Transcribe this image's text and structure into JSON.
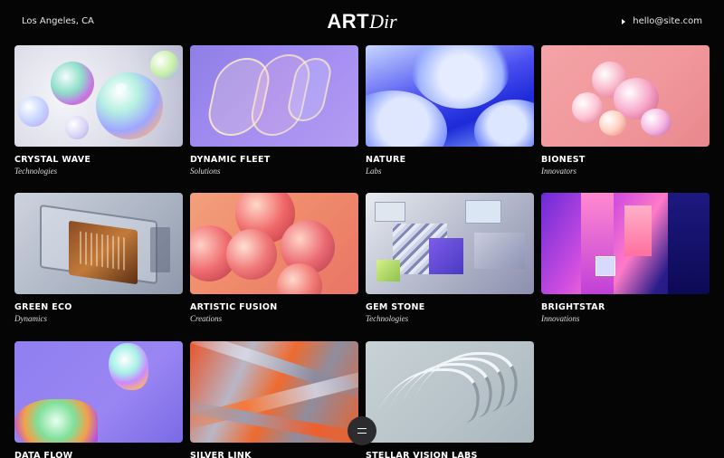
{
  "header": {
    "location": "Los Angeles, CA",
    "logo_bold": "ART",
    "logo_italic": "Dir",
    "contact_email": "hello@site.com"
  },
  "projects": [
    {
      "title": "CRYSTAL WAVE",
      "subtitle": "Technologies"
    },
    {
      "title": "DYNAMIC FLEET",
      "subtitle": "Solutions"
    },
    {
      "title": "NATURE",
      "subtitle": "Labs"
    },
    {
      "title": "BIONEST",
      "subtitle": "Innovators"
    },
    {
      "title": "GREEN ECO",
      "subtitle": "Dynamics"
    },
    {
      "title": "ARTISTIC FUSION",
      "subtitle": "Creations"
    },
    {
      "title": "GEM STONE",
      "subtitle": "Technologies"
    },
    {
      "title": "BRIGHTSTAR",
      "subtitle": "Innovations"
    },
    {
      "title": "DATA FLOW",
      "subtitle": ""
    },
    {
      "title": "SILVER LINK",
      "subtitle": ""
    },
    {
      "title": "STELLAR VISION LABS",
      "subtitle": ""
    }
  ],
  "icons": {
    "contact": "caret-right-icon",
    "menu": "menu-icon"
  },
  "colors": {
    "background": "#050505",
    "text": "#ffffff",
    "menu_button": "#2c2c2e"
  }
}
